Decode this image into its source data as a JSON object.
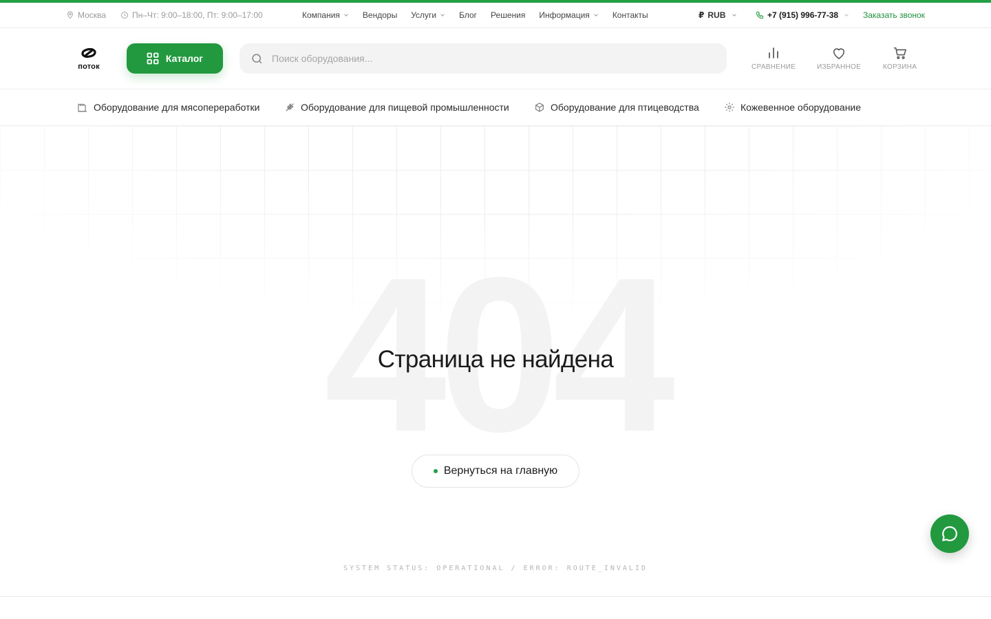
{
  "topbar": {
    "city": "Москва",
    "hours": "Пн–Чт: 9:00–18:00, Пт: 9:00–17:00",
    "nav": [
      {
        "label": "Компания",
        "dropdown": true
      },
      {
        "label": "Вендоры",
        "dropdown": false
      },
      {
        "label": "Услуги",
        "dropdown": true
      },
      {
        "label": "Блог",
        "dropdown": false
      },
      {
        "label": "Решения",
        "dropdown": false
      },
      {
        "label": "Информация",
        "dropdown": true
      },
      {
        "label": "Контакты",
        "dropdown": false
      }
    ],
    "currency_symbol": "₽",
    "currency": "RUB",
    "phone": "+7 (915) 996-77-38",
    "callback": "Заказать звонок"
  },
  "header": {
    "logo_text": "поток",
    "catalog_label": "Каталог",
    "search_placeholder": "Поиск оборудования...",
    "actions": {
      "compare": "СРАВНЕНИЕ",
      "favorites": "ИЗБРАННОЕ",
      "cart": "КОРЗИНА"
    }
  },
  "categories": [
    {
      "label": "Оборудование для мясопереработки",
      "icon": "factory-icon"
    },
    {
      "label": "Оборудование для пищевой промышленности",
      "icon": "wheat-icon"
    },
    {
      "label": "Оборудование для птицеводства",
      "icon": "box-icon"
    },
    {
      "label": "Кожевенное оборудование",
      "icon": "gear-icon"
    }
  ],
  "main": {
    "code": "404",
    "title": "Страница не найдена",
    "home_button": "Вернуться на главную",
    "status": "SYSTEM STATUS: OPERATIONAL / ERROR: ROUTE_INVALID"
  },
  "colors": {
    "accent": "#22993f",
    "accent_light": "#22a045"
  }
}
